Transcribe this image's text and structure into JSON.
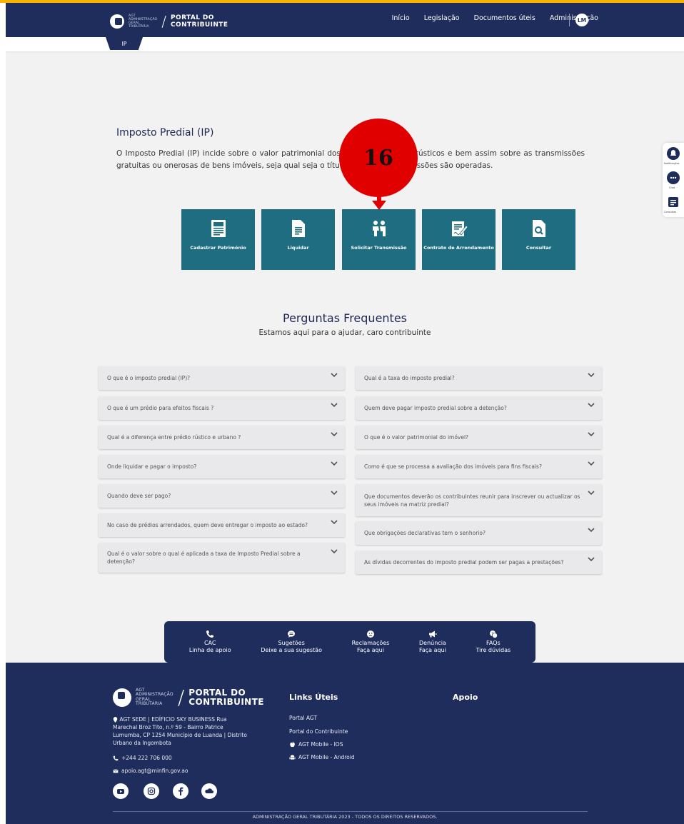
{
  "header": {
    "logo_small_lines": [
      "AGT",
      "ADMINISTRAÇÃO",
      "GERAL",
      "TRIBUTÁRIA"
    ],
    "logo_title_1": "PORTAL DO",
    "logo_title_2": "CONTRIBUINTE",
    "nav": [
      "Início",
      "Legislação",
      "Documentos úteis",
      "Administração"
    ],
    "avatar_initials": "LM",
    "active_tab": "IP"
  },
  "intro": {
    "title": "Imposto Predial (IP)",
    "text": "O Imposto Predial (IP) incide sobre o valor patrimonial dos prédios urbanos e rústicos e bem assim sobre as transmissões gratuitas ou onerosas de bens imóveis, seja qual seja o título a que tais transmissões são operadas."
  },
  "services": [
    {
      "label": "Cadastrar Património",
      "icon": "register-document-icon"
    },
    {
      "label": "Liquidar",
      "icon": "document-icon"
    },
    {
      "label": "Solicitar Transmissão",
      "icon": "handshake-people-icon"
    },
    {
      "label": "Contrato de Arrendamento",
      "icon": "contract-sign-icon"
    },
    {
      "label": "Consultar",
      "icon": "search-document-icon"
    }
  ],
  "annotation": {
    "number": "16",
    "color": "#e00000"
  },
  "faq": {
    "title": "Perguntas Frequentes",
    "subtitle": "Estamos aqui para o ajudar, caro contribuinte",
    "left": [
      "O que é o imposto predial (IP)?",
      "O que é um prédio para efeitos fiscais ?",
      "Qual é a diferença entre prédio rústico e urbano ?",
      "Onde liquidar e pagar o imposto?",
      "Quando deve ser pago?",
      "No caso de prédios arrendados, quem deve entregar o imposto ao estado?",
      "Qual é o valor sobre o qual é aplicada a taxa de Imposto Predial sobre a detenção?"
    ],
    "right": [
      "Qual é a taxa do imposto predial?",
      "Quem deve pagar imposto predial sobre a detenção?",
      "O que é o valor patrimonial do imóvel?",
      "Como é que se processa a avaliação dos imóveis para fins fiscais?",
      "Que documentos deverão os contribuintes reunir para inscrever ou actualizar os seus imóveis na matriz predial?",
      "Que obrigações declarativas tem o senhorio?",
      "As dívidas decorrentes do imposto predial podem ser pagas a prestações?"
    ]
  },
  "side_widgets": [
    "Notificações",
    "Chat",
    "Consultas"
  ],
  "contact_bar": [
    {
      "title": "CAC",
      "sub": "Linha de apoio",
      "icon": "phone-icon"
    },
    {
      "title": "Sugetões",
      "sub": "Deixe a sua sugestão",
      "icon": "chat-bubble-icon"
    },
    {
      "title": "Reclamações",
      "sub": "Faça aqui",
      "icon": "sad-face-icon"
    },
    {
      "title": "Denúncia",
      "sub": "Faça aqui",
      "icon": "megaphone-icon"
    },
    {
      "title": "FAQs",
      "sub": "Tire dúvidas",
      "icon": "faq-icon"
    }
  ],
  "footer": {
    "address": "AGT SEDE | EDÍFICIO SKY BUSINESS Rua Marechal Broz Tito, n.º 59 - Bairro Patrice Lumumba, CP 1254 Município de Luanda | Distrito Urbano da Ingombota",
    "phone": "+244 222 706 000",
    "email": "apoio.agt@minfin.gov.ao",
    "links_title": "Links Úteis",
    "links": [
      "Portal AGT",
      "Portal do Contribuinte",
      "AGT Mobile - IOS",
      "AGT Mobile - Android"
    ],
    "support_title": "Apoio",
    "social": [
      "youtube-icon",
      "instagram-icon",
      "facebook-icon",
      "soundcloud-icon"
    ],
    "copyright": "ADMINISTRAÇÃO GERAL TRIBUTÁRIA 2023 - TODOS OS DIREITOS RESERVADOS."
  },
  "colors": {
    "navy": "#1f2d5c",
    "teal": "#1e6d80",
    "accent_stripe": "#f5b400"
  }
}
